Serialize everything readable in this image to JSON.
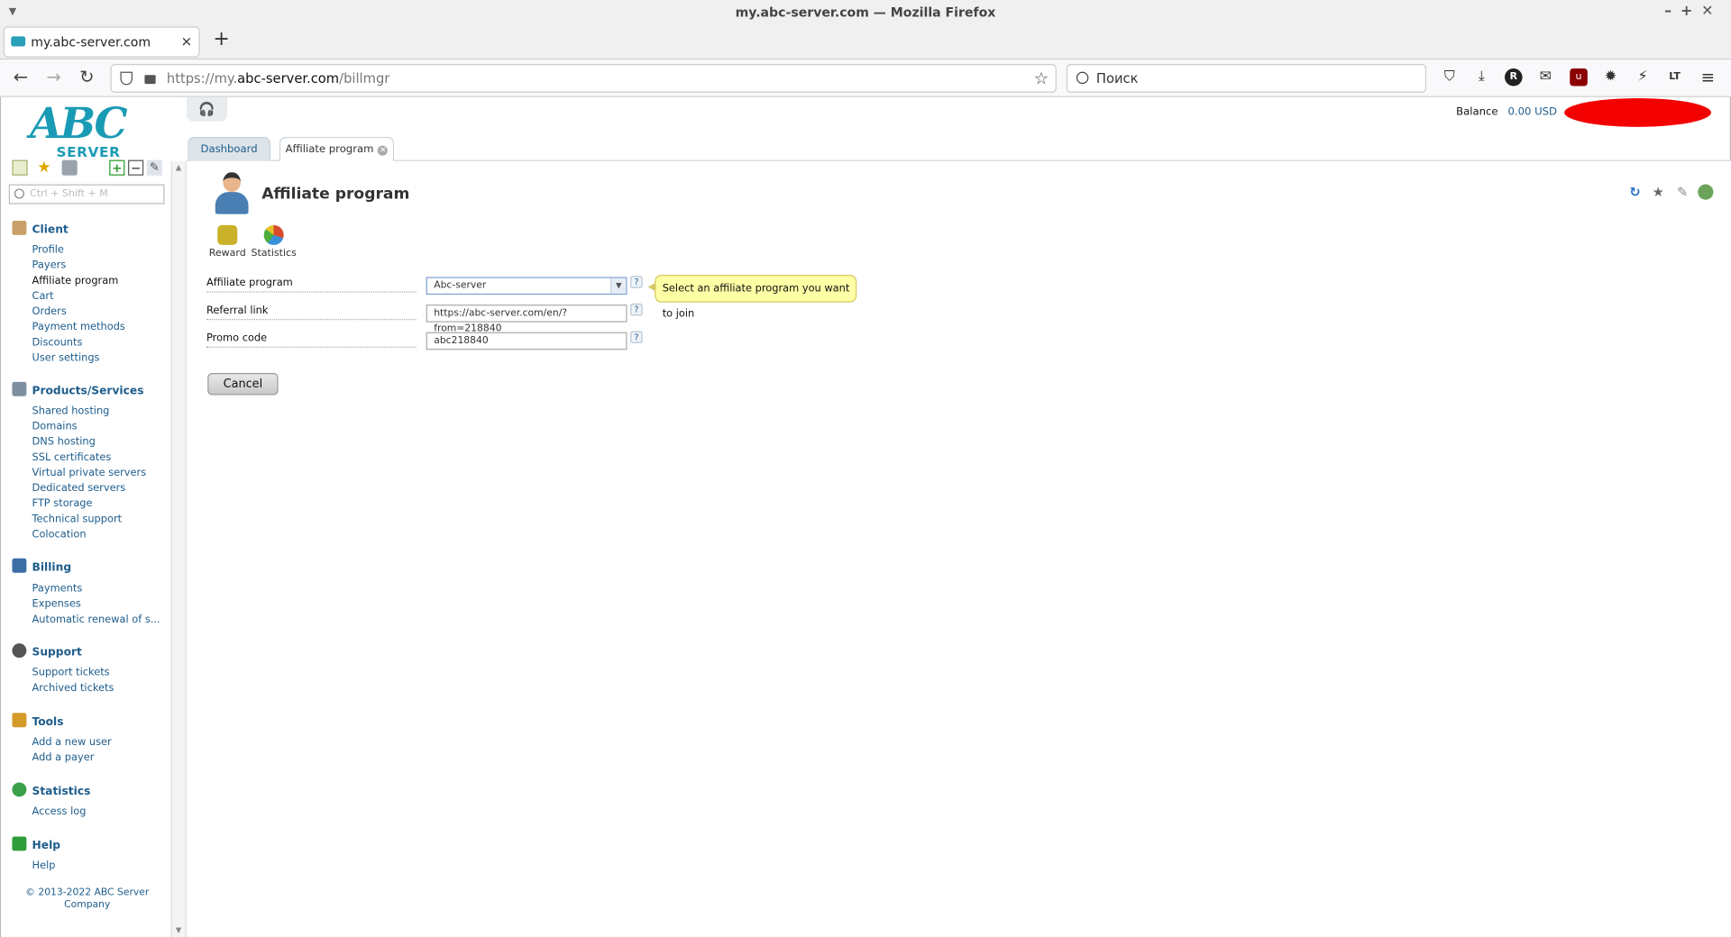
{
  "browser": {
    "window_title": "my.abc-server.com — Mozilla Firefox",
    "tab_title": "my.abc-server.com",
    "url_prefix": "https://my.",
    "url_domain": "abc-server.com",
    "url_path": "/billmgr",
    "search_placeholder": "Поиск"
  },
  "logo": {
    "abc": "ABC",
    "server": "SERVER"
  },
  "sidebar": {
    "search_placeholder": "Ctrl + Shift + M",
    "sections": [
      {
        "title": "Client",
        "items": [
          "Profile",
          "Payers",
          "Affiliate program",
          "Cart",
          "Orders",
          "Payment methods",
          "Discounts",
          "User settings"
        ]
      },
      {
        "title": "Products/Services",
        "items": [
          "Shared hosting",
          "Domains",
          "DNS hosting",
          "SSL certificates",
          "Virtual private servers",
          "Dedicated servers",
          "FTP storage",
          "Technical support",
          "Colocation"
        ]
      },
      {
        "title": "Billing",
        "items": [
          "Payments",
          "Expenses",
          "Automatic renewal of s..."
        ]
      },
      {
        "title": "Support",
        "items": [
          "Support tickets",
          "Archived tickets"
        ]
      },
      {
        "title": "Tools",
        "items": [
          "Add a new user",
          "Add a payer"
        ]
      },
      {
        "title": "Statistics",
        "items": [
          "Access log"
        ]
      },
      {
        "title": "Help",
        "items": [
          "Help"
        ]
      }
    ],
    "copyright": "© 2013-2022 ABC Server Company"
  },
  "header": {
    "balance_label": "Balance",
    "balance_value": "0.00 USD"
  },
  "tabs": {
    "dashboard": "Dashboard",
    "affiliate": "Affiliate program"
  },
  "page": {
    "title": "Affiliate program",
    "toolbar": {
      "reward": "Reward",
      "statistics": "Statistics"
    },
    "form": {
      "affiliate_label": "Affiliate program",
      "affiliate_value": "Abc-server",
      "referral_label": "Referral link",
      "referral_value": "https://abc-server.com/en/?from=218840",
      "promo_label": "Promo code",
      "promo_value": "abc218840"
    },
    "tooltip": "Select an affiliate program you want to join",
    "cancel": "Cancel"
  },
  "colors": {
    "accent": "#1e5d8c",
    "logo": "#1a9bb5",
    "redaction": "#f30000",
    "tooltip_bg": "#ffffa6"
  }
}
